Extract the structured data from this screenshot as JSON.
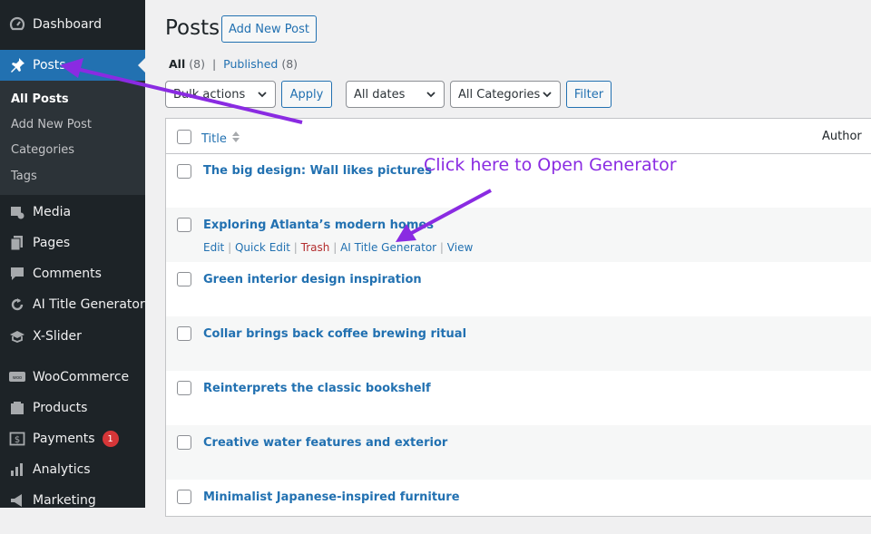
{
  "sidebar": {
    "items": [
      {
        "label": "Dashboard",
        "icon": "dashboard-icon"
      },
      {
        "label": "Posts",
        "icon": "pin-icon"
      },
      {
        "label": "Media",
        "icon": "media-icon"
      },
      {
        "label": "Pages",
        "icon": "pages-icon"
      },
      {
        "label": "Comments",
        "icon": "comments-icon"
      },
      {
        "label": "AI Title Generator",
        "icon": "refresh-icon"
      },
      {
        "label": "X-Slider",
        "icon": "slider-icon"
      },
      {
        "label": "WooCommerce",
        "icon": "woo-icon"
      },
      {
        "label": "Products",
        "icon": "products-icon"
      },
      {
        "label": "Payments",
        "icon": "payments-icon",
        "badge": "1"
      },
      {
        "label": "Analytics",
        "icon": "analytics-icon"
      },
      {
        "label": "Marketing",
        "icon": "marketing-icon"
      }
    ],
    "submenu": [
      "All Posts",
      "Add New Post",
      "Categories",
      "Tags"
    ]
  },
  "header": {
    "title": "Posts",
    "add_new": "Add New Post"
  },
  "views": {
    "all_label": "All",
    "all_count": "(8)",
    "separator": "|",
    "published_label": "Published",
    "published_count": "(8)"
  },
  "filters": {
    "bulk_actions": "Bulk actions",
    "apply": "Apply",
    "dates": "All dates",
    "categories": "All Categories",
    "filter": "Filter"
  },
  "table": {
    "columns": {
      "title": "Title",
      "author": "Author"
    },
    "rows": [
      "The big design: Wall likes pictures",
      "Exploring Atlanta’s modern homes",
      "Green interior design inspiration",
      "Collar brings back coffee brewing ritual",
      "Reinterprets the classic bookshelf",
      "Creative water features and exterior",
      "Minimalist Japanese-inspired furniture"
    ],
    "row_actions": {
      "edit": "Edit",
      "quick_edit": "Quick Edit",
      "trash": "Trash",
      "ai": "AI Title Generator",
      "view": "View",
      "sep": "|"
    }
  },
  "annotation": {
    "text": "Click here to Open Generator",
    "color": "#8a2be2"
  },
  "colors": {
    "sidebar_bg": "#1d2327",
    "accent": "#2271b1",
    "annotation": "#8a2be2",
    "badge": "#d63638"
  }
}
